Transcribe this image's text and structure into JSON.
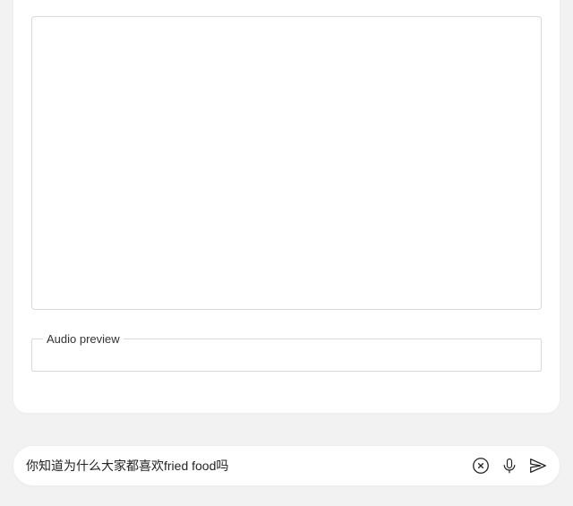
{
  "card": {
    "textarea_value": "",
    "audio_preview_legend": "Audio preview"
  },
  "inputbar": {
    "value": "你知道为什么大家都喜欢fried food吗",
    "placeholder": ""
  },
  "icons": {
    "cancel": "cancel-icon",
    "mic": "microphone-icon",
    "send": "send-icon"
  }
}
